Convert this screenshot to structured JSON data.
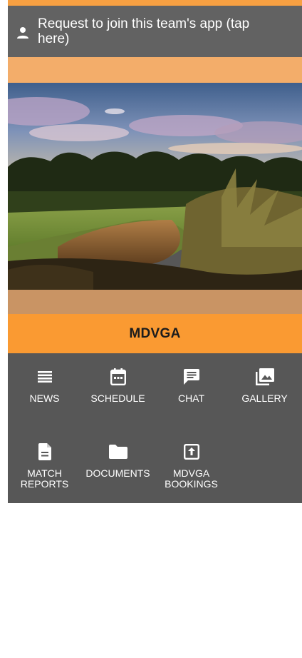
{
  "join_banner": {
    "text": "Request to join this team's app (tap here)",
    "icon": "person-icon"
  },
  "team": {
    "name": "MDVGA"
  },
  "menu": {
    "items": [
      {
        "label": "NEWS",
        "icon": "list-icon"
      },
      {
        "label": "SCHEDULE",
        "icon": "calendar-icon"
      },
      {
        "label": "CHAT",
        "icon": "chat-icon"
      },
      {
        "label": "GALLERY",
        "icon": "gallery-icon"
      },
      {
        "label": "MATCH\nREPORTS",
        "icon": "document-icon"
      },
      {
        "label": "DOCUMENTS",
        "icon": "folder-icon"
      },
      {
        "label": "MDVGA\nBOOKINGS",
        "icon": "bookings-icon"
      }
    ]
  },
  "colors": {
    "accent_orange": "#fa9a32",
    "band_orange": "#f3ad6a",
    "panel_gray": "#575757",
    "banner_gray": "#626262"
  }
}
